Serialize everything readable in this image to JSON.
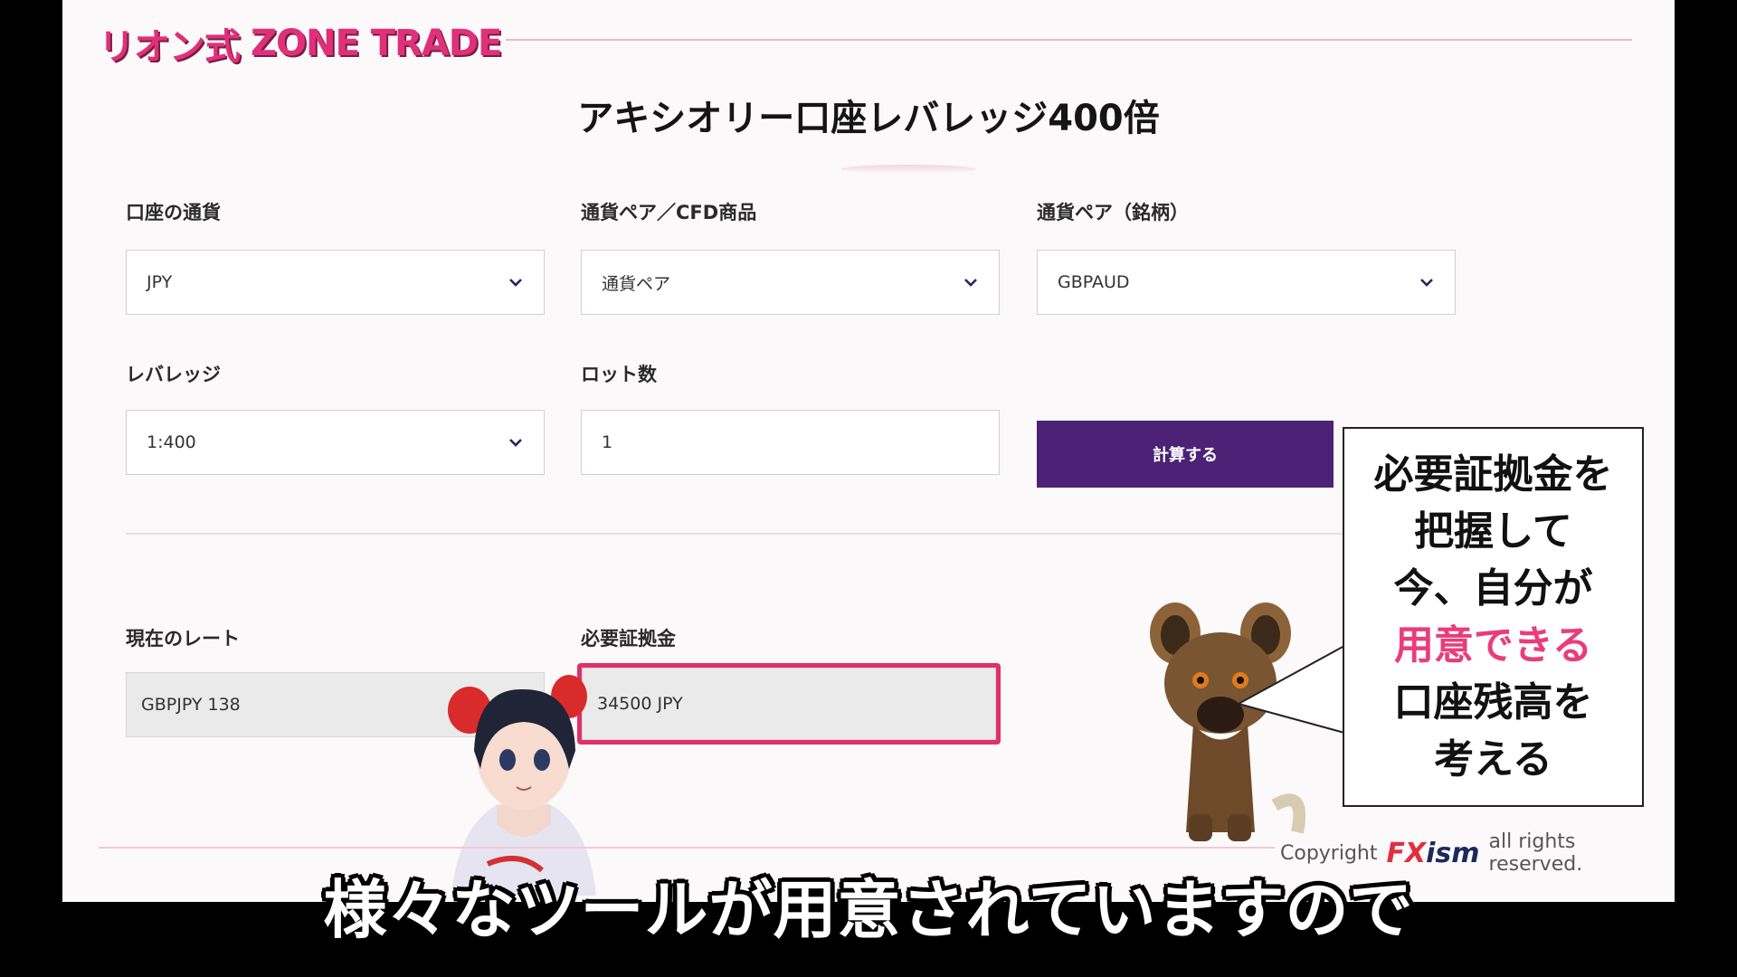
{
  "header": {
    "logo_jp": "リオン式",
    "logo_en": "ZONE TRADE"
  },
  "page": {
    "title": "アキシオリー口座レバレッジ400倍"
  },
  "form": {
    "account_currency": {
      "label": "口座の通貨",
      "value": "JPY"
    },
    "product_type": {
      "label": "通貨ペア／CFD商品",
      "value": "通貨ペア"
    },
    "symbol": {
      "label": "通貨ペア（銘柄）",
      "value": "GBPAUD"
    },
    "leverage": {
      "label": "レバレッジ",
      "value": "1:400"
    },
    "lots": {
      "label": "ロット数",
      "value": "1"
    },
    "calculate_button": "計算する"
  },
  "results": {
    "current_rate": {
      "label": "現在のレート",
      "value": "GBPJPY 138"
    },
    "required_margin": {
      "label": "必要証拠金",
      "value": "34500 JPY"
    }
  },
  "speech_bubble": {
    "line1": "必要証拠金を",
    "line2": "把握して",
    "line3": "今、自分が",
    "line4": "用意できる",
    "line5": "口座残高を",
    "line6": "考える"
  },
  "footer": {
    "copyright_prefix": "Copyright",
    "brand_fx": "FX",
    "brand_ism": "ism",
    "copyright_suffix": "all rights reserved."
  },
  "caption": {
    "text": "様々なツールが用意されていますので"
  },
  "colors": {
    "accent_purple": "#4b2276",
    "highlight_pink": "#e0306c",
    "logo_pink": "#e0307a"
  }
}
